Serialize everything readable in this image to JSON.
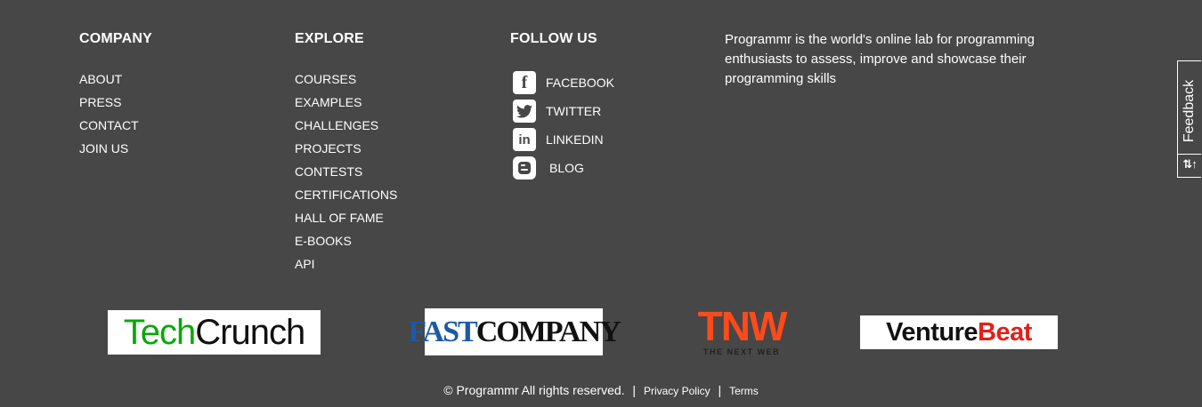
{
  "company": {
    "heading": "COMPANY",
    "links": [
      "ABOUT",
      "PRESS",
      "CONTACT",
      "JOIN US"
    ]
  },
  "explore": {
    "heading": "EXPLORE",
    "links": [
      "COURSES",
      "EXAMPLES",
      "CHALLENGES",
      "PROJECTS",
      "CONTESTS",
      "CERTIFICATIONS",
      "HALL OF FAME",
      "E-BOOKS",
      "API"
    ]
  },
  "follow": {
    "heading": "FOLLOW US",
    "items": [
      {
        "label": "FACEBOOK",
        "icon": "facebook-icon",
        "glyph": "f"
      },
      {
        "label": "TWITTER",
        "icon": "twitter-icon",
        "glyph": "🐦"
      },
      {
        "label": "LINKEDIN",
        "icon": "linkedin-icon",
        "glyph": "in"
      },
      {
        "label": "BLOG",
        "icon": "blogger-icon",
        "glyph": "B"
      }
    ]
  },
  "about": {
    "text": "Programmr is the world's online lab for programming enthusiasts to assess, improve and showcase their programming skills"
  },
  "feedback": {
    "label": "Feedback",
    "icon": "sort-icon",
    "glyph": "⇅↑"
  },
  "press_logos": {
    "techcrunch": {
      "part1": "Tech",
      "part2": "Crunch"
    },
    "fastcompany": {
      "part1": "FAST",
      "part2": "COMPANY"
    },
    "tnw": {
      "main": "TNW",
      "sub": "THE NEXT WEB"
    },
    "venturebeat": {
      "part1": "Venture",
      "part2": "Beat"
    }
  },
  "footer": {
    "copyright": "© Programmr All rights reserved.",
    "sep1": "|",
    "privacy": "Privacy Policy",
    "sep2": "|",
    "terms": "Terms"
  },
  "colors": {
    "background": "#474747",
    "text": "#ffffff",
    "techcrunch_green": "#0aa70a",
    "fastcompany_blue": "#1c5aa6",
    "tnw_orange": "#ff4a1c",
    "venturebeat_red": "#e3201b"
  }
}
